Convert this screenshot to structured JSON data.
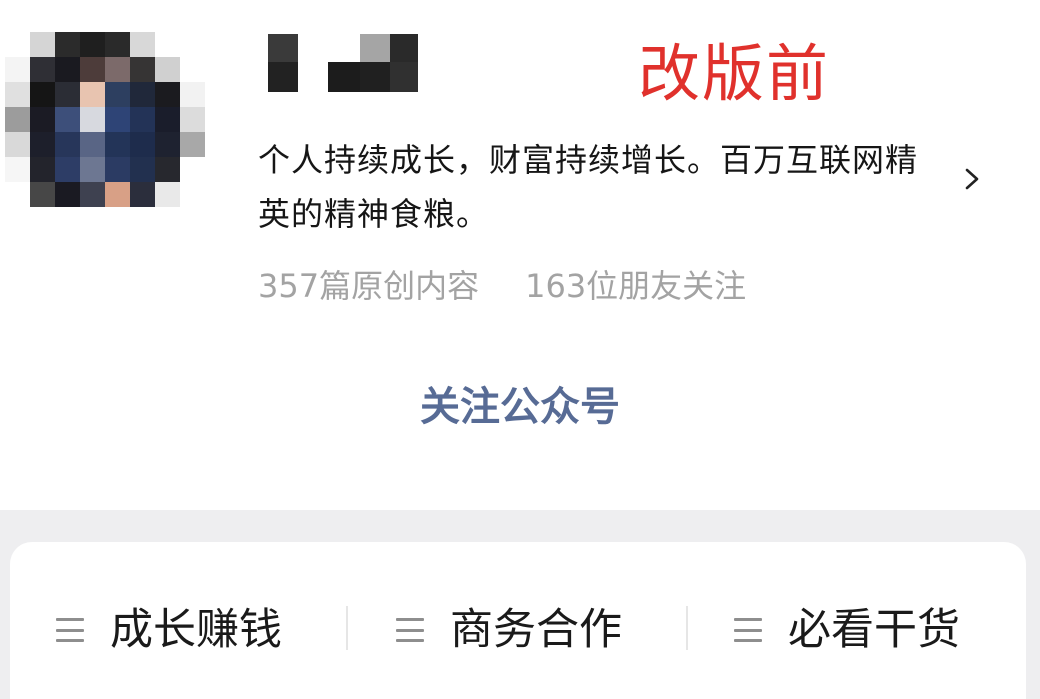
{
  "profile": {
    "description": "个人持续成长，财富持续增长。百万互联网精英的精神食粮。",
    "stats": {
      "articles": "357篇原创内容",
      "followers": "163位朋友关注"
    },
    "follow_label": "关注公众号"
  },
  "annotation": "改版前",
  "menu": {
    "items": [
      {
        "label": "成长赚钱"
      },
      {
        "label": "商务合作"
      },
      {
        "label": "必看干货"
      }
    ]
  },
  "colors": {
    "accent_link": "#576b95",
    "annotation_red": "#e0312c",
    "muted_text": "#a3a3a3",
    "page_bg_gray": "#eeeef0"
  },
  "icons": {
    "chevron": "chevron-right-icon",
    "menu": "menu-lines-icon"
  }
}
